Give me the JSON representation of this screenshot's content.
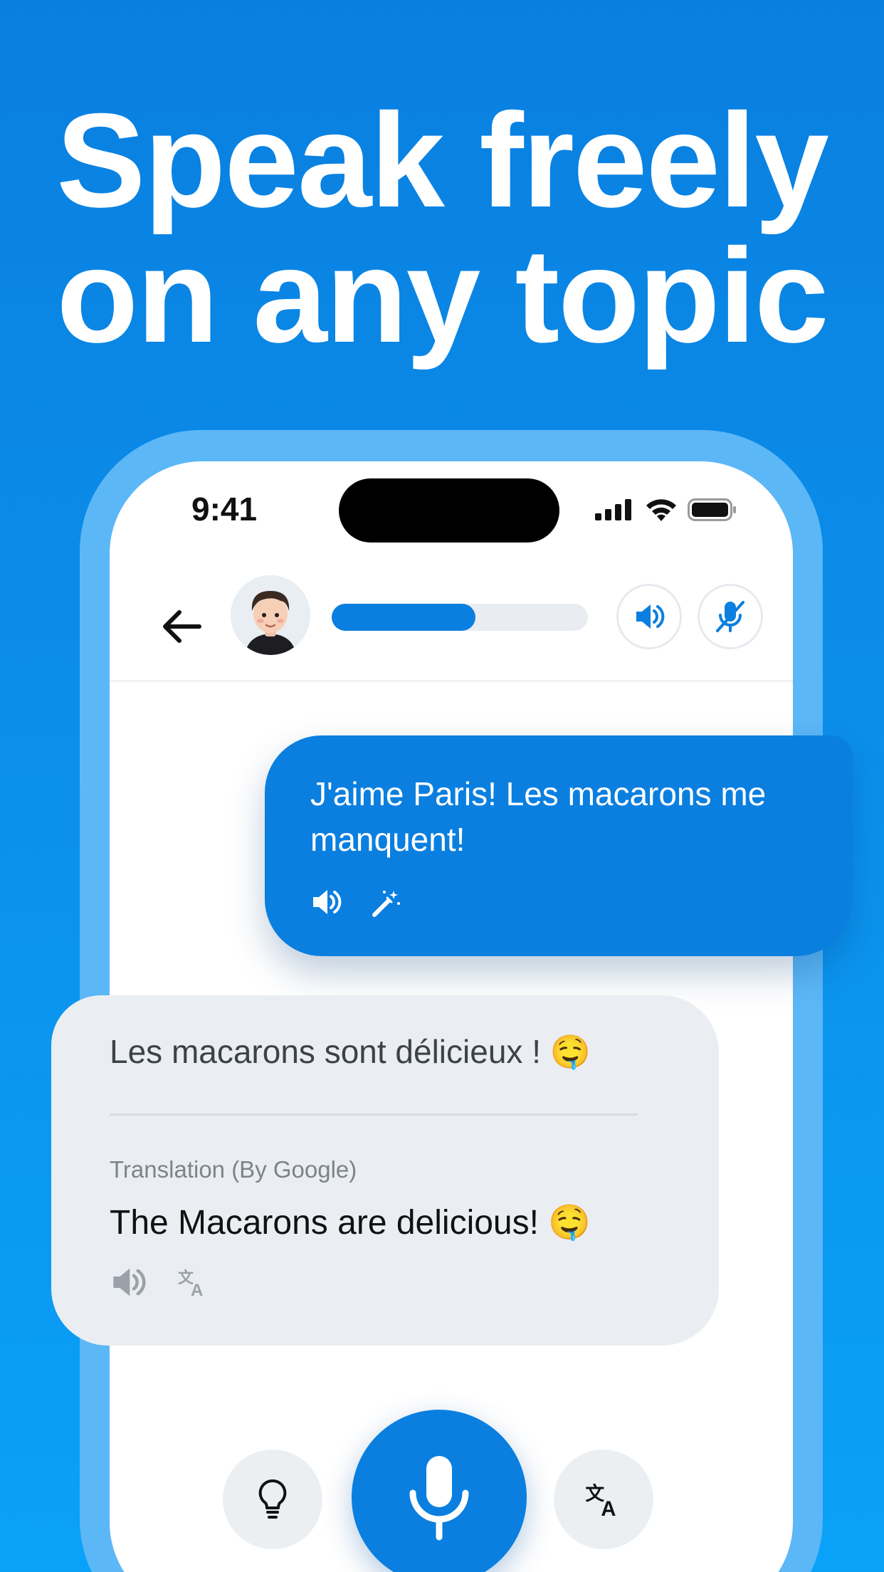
{
  "headline": {
    "line1": "Speak freely",
    "line2": "on any topic"
  },
  "status_bar": {
    "time": "9:41"
  },
  "topbar": {
    "progress_fraction": 0.56
  },
  "user_message": {
    "text": "J'aime Paris! Les macarons me manquent!"
  },
  "bot_message": {
    "original": "Les macarons sont délicieux ! 🤤",
    "translation_label": "Translation (By Google)",
    "translation": "The Macarons are delicious! 🤤"
  },
  "colors": {
    "brand_blue": "#0a7fe0",
    "bubble_gray": "#eaeef2"
  },
  "icons": [
    "back-arrow-icon",
    "avatar",
    "speaker-icon",
    "mic-off-icon",
    "magic-wand-icon",
    "translate-icon",
    "lightbulb-icon",
    "mic-icon"
  ]
}
